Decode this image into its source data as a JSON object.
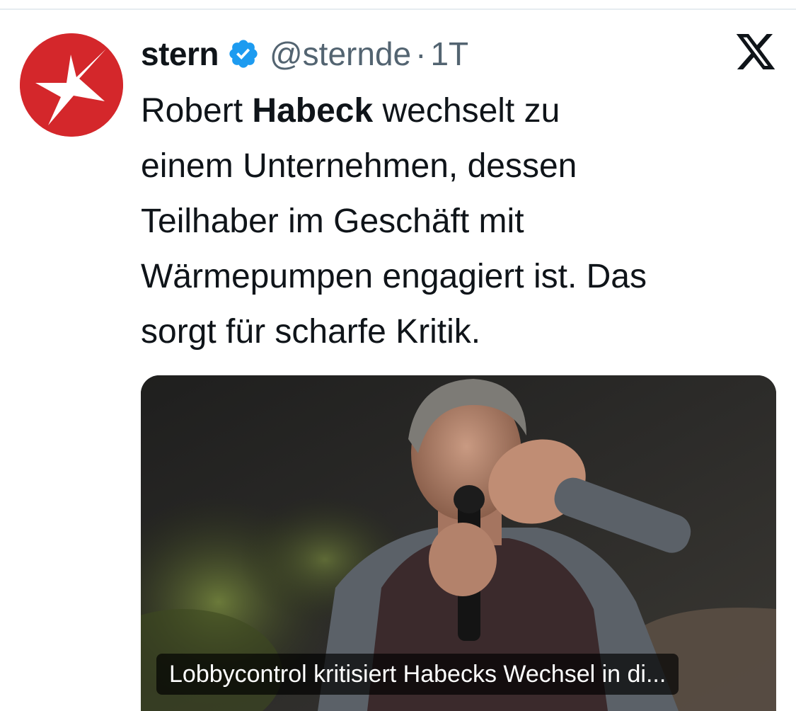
{
  "tweet": {
    "display_name": "stern",
    "handle": "@sternde",
    "separator": "·",
    "time": "1T",
    "text_lines": [
      {
        "before": "Robert ",
        "bold": "Habeck",
        "after": " wechselt zu"
      },
      {
        "before": "einem Unternehmen, dessen",
        "bold": "",
        "after": ""
      },
      {
        "before": "Teilhaber im Geschäft mit",
        "bold": "",
        "after": ""
      },
      {
        "before": "Wärmepumpen engagiert ist. Das",
        "bold": "",
        "after": ""
      },
      {
        "before": "sorgt für scharfe Kritik.",
        "bold": "",
        "after": ""
      }
    ]
  },
  "media": {
    "caption": "Lobbycontrol kritisiert Habecks Wechsel in di..."
  },
  "icons": {
    "avatar": "stern-logo-icon",
    "verified": "verified-badge-icon",
    "platform": "x-logo-icon"
  },
  "colors": {
    "brand_red": "#d4272b",
    "verified_blue": "#1d9bf0",
    "text_primary": "#0f1419",
    "text_secondary": "#536471"
  }
}
